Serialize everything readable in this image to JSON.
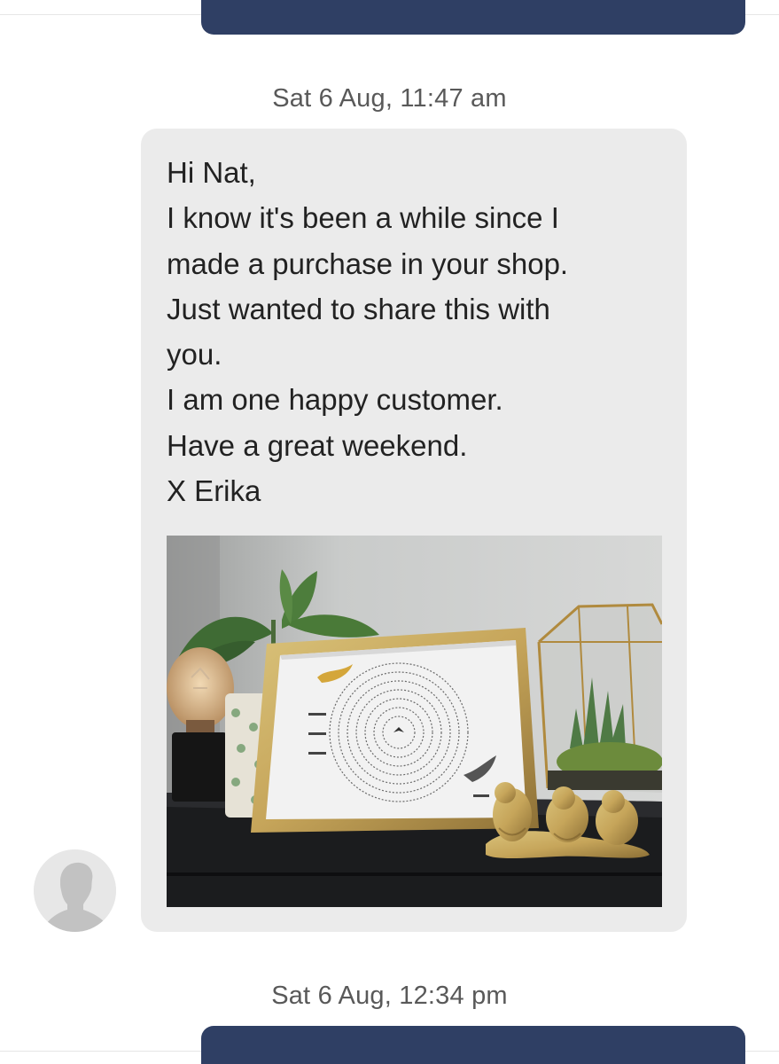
{
  "conversation": {
    "timestamps": [
      "Sat 6 Aug, 11:47 am",
      "Sat 6 Aug, 12:34 pm"
    ],
    "received_message": {
      "text": "Hi Nat,\nI know it's been a while since I\nmade a purchase in your shop.\nJust wanted to share this with\nyou.\nI am one happy customer.\nHave a great weekend.\nX Erika",
      "attachment_icon": "photo-of-framed-bird-print"
    },
    "avatar_icon": "default-user-avatar-icon"
  },
  "colors": {
    "sent_bubble": "#2f3f64",
    "received_bubble": "#ebebeb",
    "timestamp_text": "#595959",
    "message_text": "#222222"
  }
}
